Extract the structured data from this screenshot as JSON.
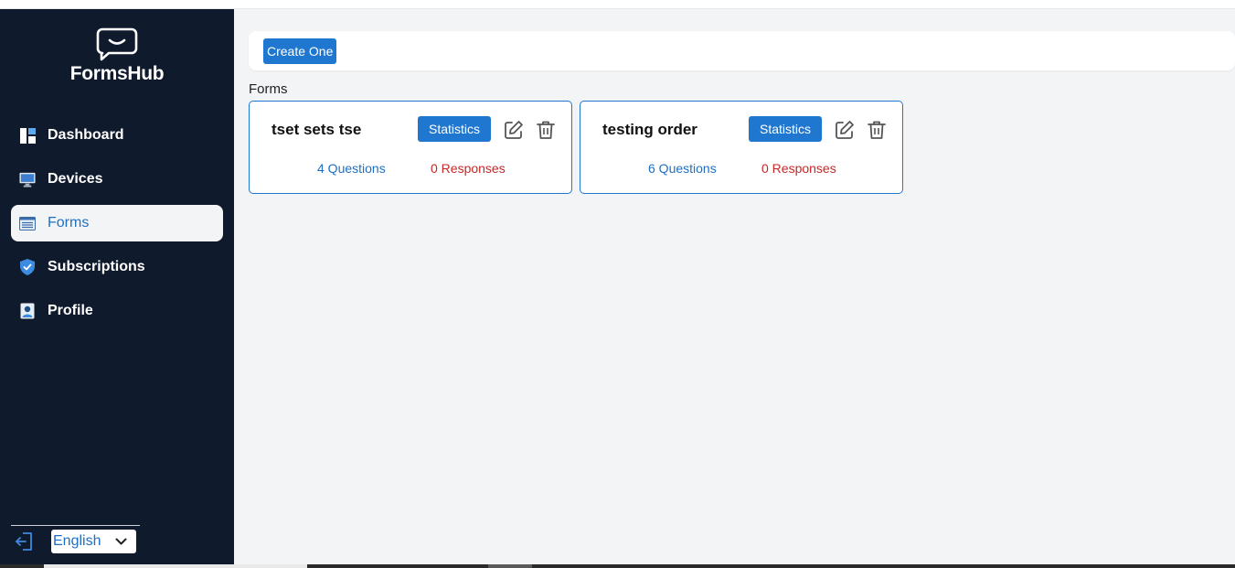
{
  "app": {
    "name": "FormsHub"
  },
  "sidebar": {
    "items": [
      {
        "label": "Dashboard",
        "icon": "dashboard-icon",
        "active": false
      },
      {
        "label": "Devices",
        "icon": "monitor-icon",
        "active": false
      },
      {
        "label": "Forms",
        "icon": "form-icon",
        "active": true
      },
      {
        "label": "Subscriptions",
        "icon": "shield-check-icon",
        "active": false
      },
      {
        "label": "Profile",
        "icon": "user-badge-icon",
        "active": false
      }
    ],
    "language": "English"
  },
  "toolbar": {
    "create_label": "Create One"
  },
  "forms_section": {
    "label": "Forms"
  },
  "forms": [
    {
      "title": "tset sets tse",
      "stats_label": "Statistics",
      "questions": "4 Questions",
      "responses": "0 Responses"
    },
    {
      "title": "testing order",
      "stats_label": "Statistics",
      "questions": "6 Questions",
      "responses": "0 Responses"
    }
  ],
  "colors": {
    "sidebar_bg": "#0f1a2c",
    "accent": "#1f77d0",
    "responses": "#c62828",
    "main_bg": "#f3f4f6"
  }
}
